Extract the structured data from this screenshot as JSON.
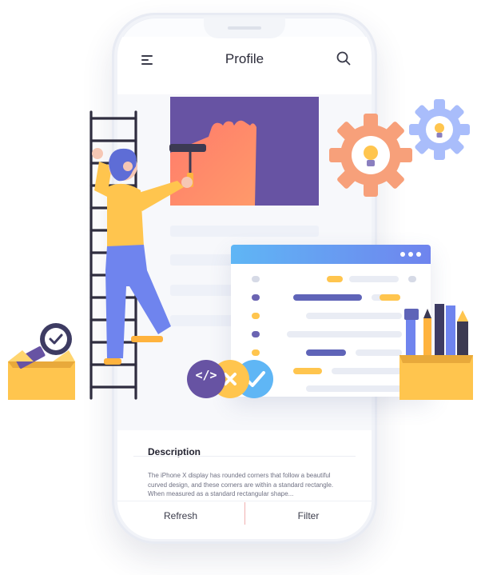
{
  "header": {
    "title": "Profile"
  },
  "description": {
    "title": "Description",
    "text": "The iPhone X display has rounded corners that follow a beautiful curved design, and these corners are within a standard rectangle. When measured as a standard rectangular shape..."
  },
  "bottom_bar": {
    "refresh_label": "Refresh",
    "filter_label": "Filter"
  },
  "code_badge": {
    "label": "</>"
  },
  "colors": {
    "accent_purple": "#6753a3",
    "accent_blue": "#5fb6f5",
    "accent_orange": "#ffb33e",
    "gear_orange": "#f7a07a",
    "gear_blue": "#a9bdfb"
  }
}
